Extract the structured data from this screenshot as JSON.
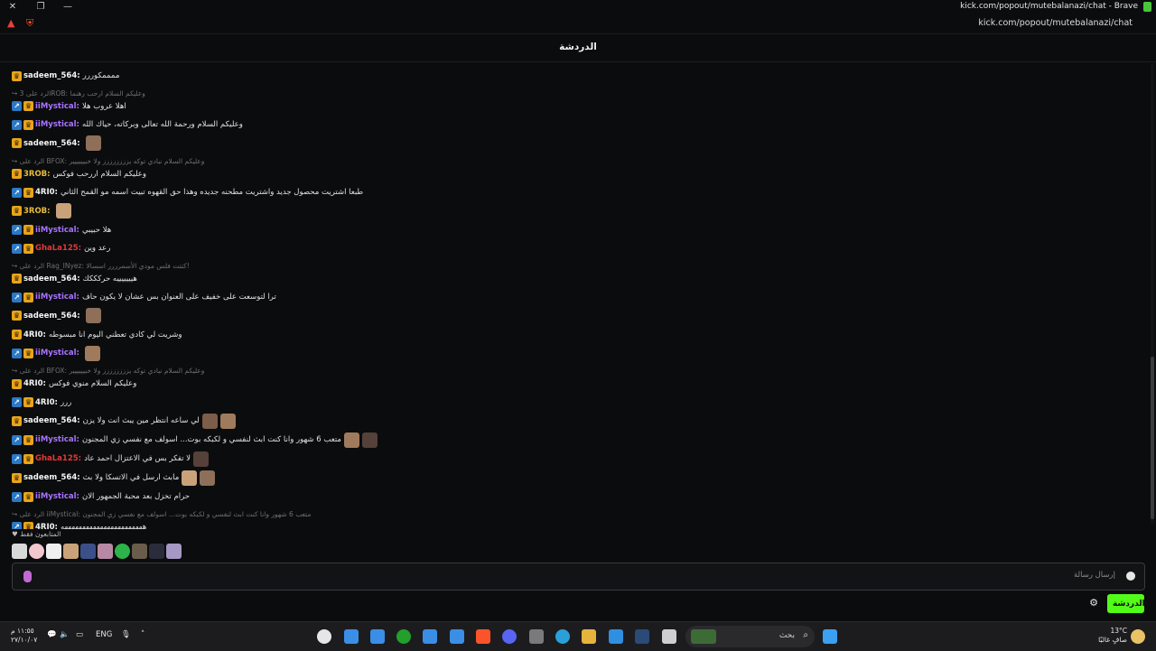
{
  "window": {
    "title": "kick.com/popout/mutebalanazi/chat - Brave",
    "url": "kick.com/popout/mutebalanazi/chat",
    "close_glyph": "✕",
    "restore_glyph": "❐",
    "minimize_glyph": "—"
  },
  "chat": {
    "title": "الدردشة",
    "messages": [
      {
        "badges": [
          "sub"
        ],
        "user": "sadeem_564:",
        "color": "sadeem",
        "text": "ممممكوررر",
        "emotes": 0
      },
      {
        "reply": "الرد على 3ROB: وعليكم السلام ارحب رهنما"
      },
      {
        "badges": [
          "vip",
          "sub"
        ],
        "user": "iiMystical:",
        "color": "mystic",
        "text": "اهلا عروب هلا",
        "emotes": 0
      },
      {
        "badges": [
          "vip",
          "sub"
        ],
        "user": "iiMystical:",
        "color": "mystic",
        "text": "وعليكم السلام ورحمة الله تعالى وبركاته، حياك الله",
        "emotes": 0
      },
      {
        "badges": [
          "sub"
        ],
        "user": "sadeem_564:",
        "color": "sadeem",
        "text": "",
        "emotes": 1
      },
      {
        "reply": "الرد على BFOX: وعليكم السلام نبادي توكه يزززززززز ولا خبيييييير"
      },
      {
        "badges": [
          "sub"
        ],
        "user": "3ROB:",
        "color": "3rob",
        "text": "وعليكم السلام اررحب فوكس",
        "emotes": 0
      },
      {
        "badges": [
          "vip",
          "sub"
        ],
        "user": "4RI0:",
        "color": "4rio",
        "text": "طبعا اشتريت محصول جديد واشتريت مطحنه جديده وهذا حق القهوه تبيت اسمه مو القمح الثاني",
        "emotes": 0
      },
      {
        "badges": [
          "sub"
        ],
        "user": "3ROB:",
        "color": "3rob",
        "text": "",
        "emotes": 1
      },
      {
        "badges": [
          "vip",
          "sub"
        ],
        "user": "iiMystical:",
        "color": "mystic",
        "text": "هلا حبيبي",
        "emotes": 0
      },
      {
        "badges": [
          "vip",
          "sub"
        ],
        "user": "GhaLa125:",
        "color": "ghala",
        "text": "رعد وين",
        "emotes": 0
      },
      {
        "reply": "الرد على Rag_INyez: كنتت فلس مودي الأسمرررر اسسالا!"
      },
      {
        "badges": [
          "sub"
        ],
        "user": "sadeem_564:",
        "color": "sadeem",
        "text": "هيييييييه حركككك",
        "emotes": 0
      },
      {
        "badges": [
          "vip",
          "sub"
        ],
        "user": "iiMystical:",
        "color": "mystic",
        "text": "ترا لتوسعت على خفيف على العنوان بس عشان لا يكون حاف",
        "emotes": 0
      },
      {
        "badges": [
          "sub"
        ],
        "user": "sadeem_564:",
        "color": "sadeem",
        "text": "",
        "emotes": 1
      },
      {
        "badges": [
          "sub"
        ],
        "user": "4RI0:",
        "color": "4rio",
        "text": "وشريت لي كادي  تعطني اليوم انا مبسوطه",
        "emotes": 0
      },
      {
        "badges": [
          "vip",
          "sub"
        ],
        "user": "iiMystical:",
        "color": "mystic",
        "text": "",
        "emotes": 1
      },
      {
        "reply": "الرد على BFOX: وعليكم السلام نبادي توكه يزززززززز ولا خبيييييير"
      },
      {
        "badges": [
          "sub"
        ],
        "user": "4RI0:",
        "color": "4rio",
        "text": "وعليكم السلام منوي فوكس",
        "emotes": 0
      },
      {
        "badges": [
          "vip",
          "sub"
        ],
        "user": "4RI0:",
        "color": "4rio",
        "text": "ررر",
        "emotes": 0
      },
      {
        "badges": [
          "sub"
        ],
        "user": "sadeem_564:",
        "color": "sadeem",
        "text": "لي ساعه انتظر مين يبث انت ولا يزن",
        "emotes": 2
      },
      {
        "badges": [
          "vip",
          "sub"
        ],
        "user": "iiMystical:",
        "color": "mystic",
        "text": "متعب 6 شهور وانا كنت ابث لنفسي و لكبكه بوت... اسولف مع نفسي زي المجنون",
        "emotes": 2
      },
      {
        "badges": [
          "vip",
          "sub"
        ],
        "user": "GhaLa125:",
        "color": "ghala",
        "text": "لا تفكر بس في الاعتزال احمد عاد",
        "emotes": 1
      },
      {
        "badges": [
          "sub"
        ],
        "user": "sadeem_564:",
        "color": "sadeem",
        "text": "مابث ارسل في الاتسكا ولا بث",
        "emotes": 2
      },
      {
        "badges": [
          "vip",
          "sub"
        ],
        "user": "iiMystical:",
        "color": "mystic",
        "text": "حرام تخزل بعد محبة الجمهور الان",
        "emotes": 0
      },
      {
        "reply": "الرد على iiMystical: متعب 6 شهور وانا كنت ابث لنفسي و لكبكه بوت... اسولف مع نفسي زي المجنون"
      },
      {
        "badges": [
          "vip",
          "sub"
        ],
        "user": "4RI0:",
        "color": "4rio",
        "text": "هههههههههههههههههههههههه",
        "emotes": 0
      }
    ],
    "pinned_label": "المتابعون فقط",
    "input_placeholder": "إرسال رسالة",
    "send_label": "الدردشة"
  },
  "taskbar": {
    "search_placeholder": "بحث",
    "language": "ENG",
    "time": "١١:٥٥ م",
    "date": "٢٧/١٠/٠٧",
    "temperature": "13°C",
    "weather": "صافٍ غالبًا"
  }
}
